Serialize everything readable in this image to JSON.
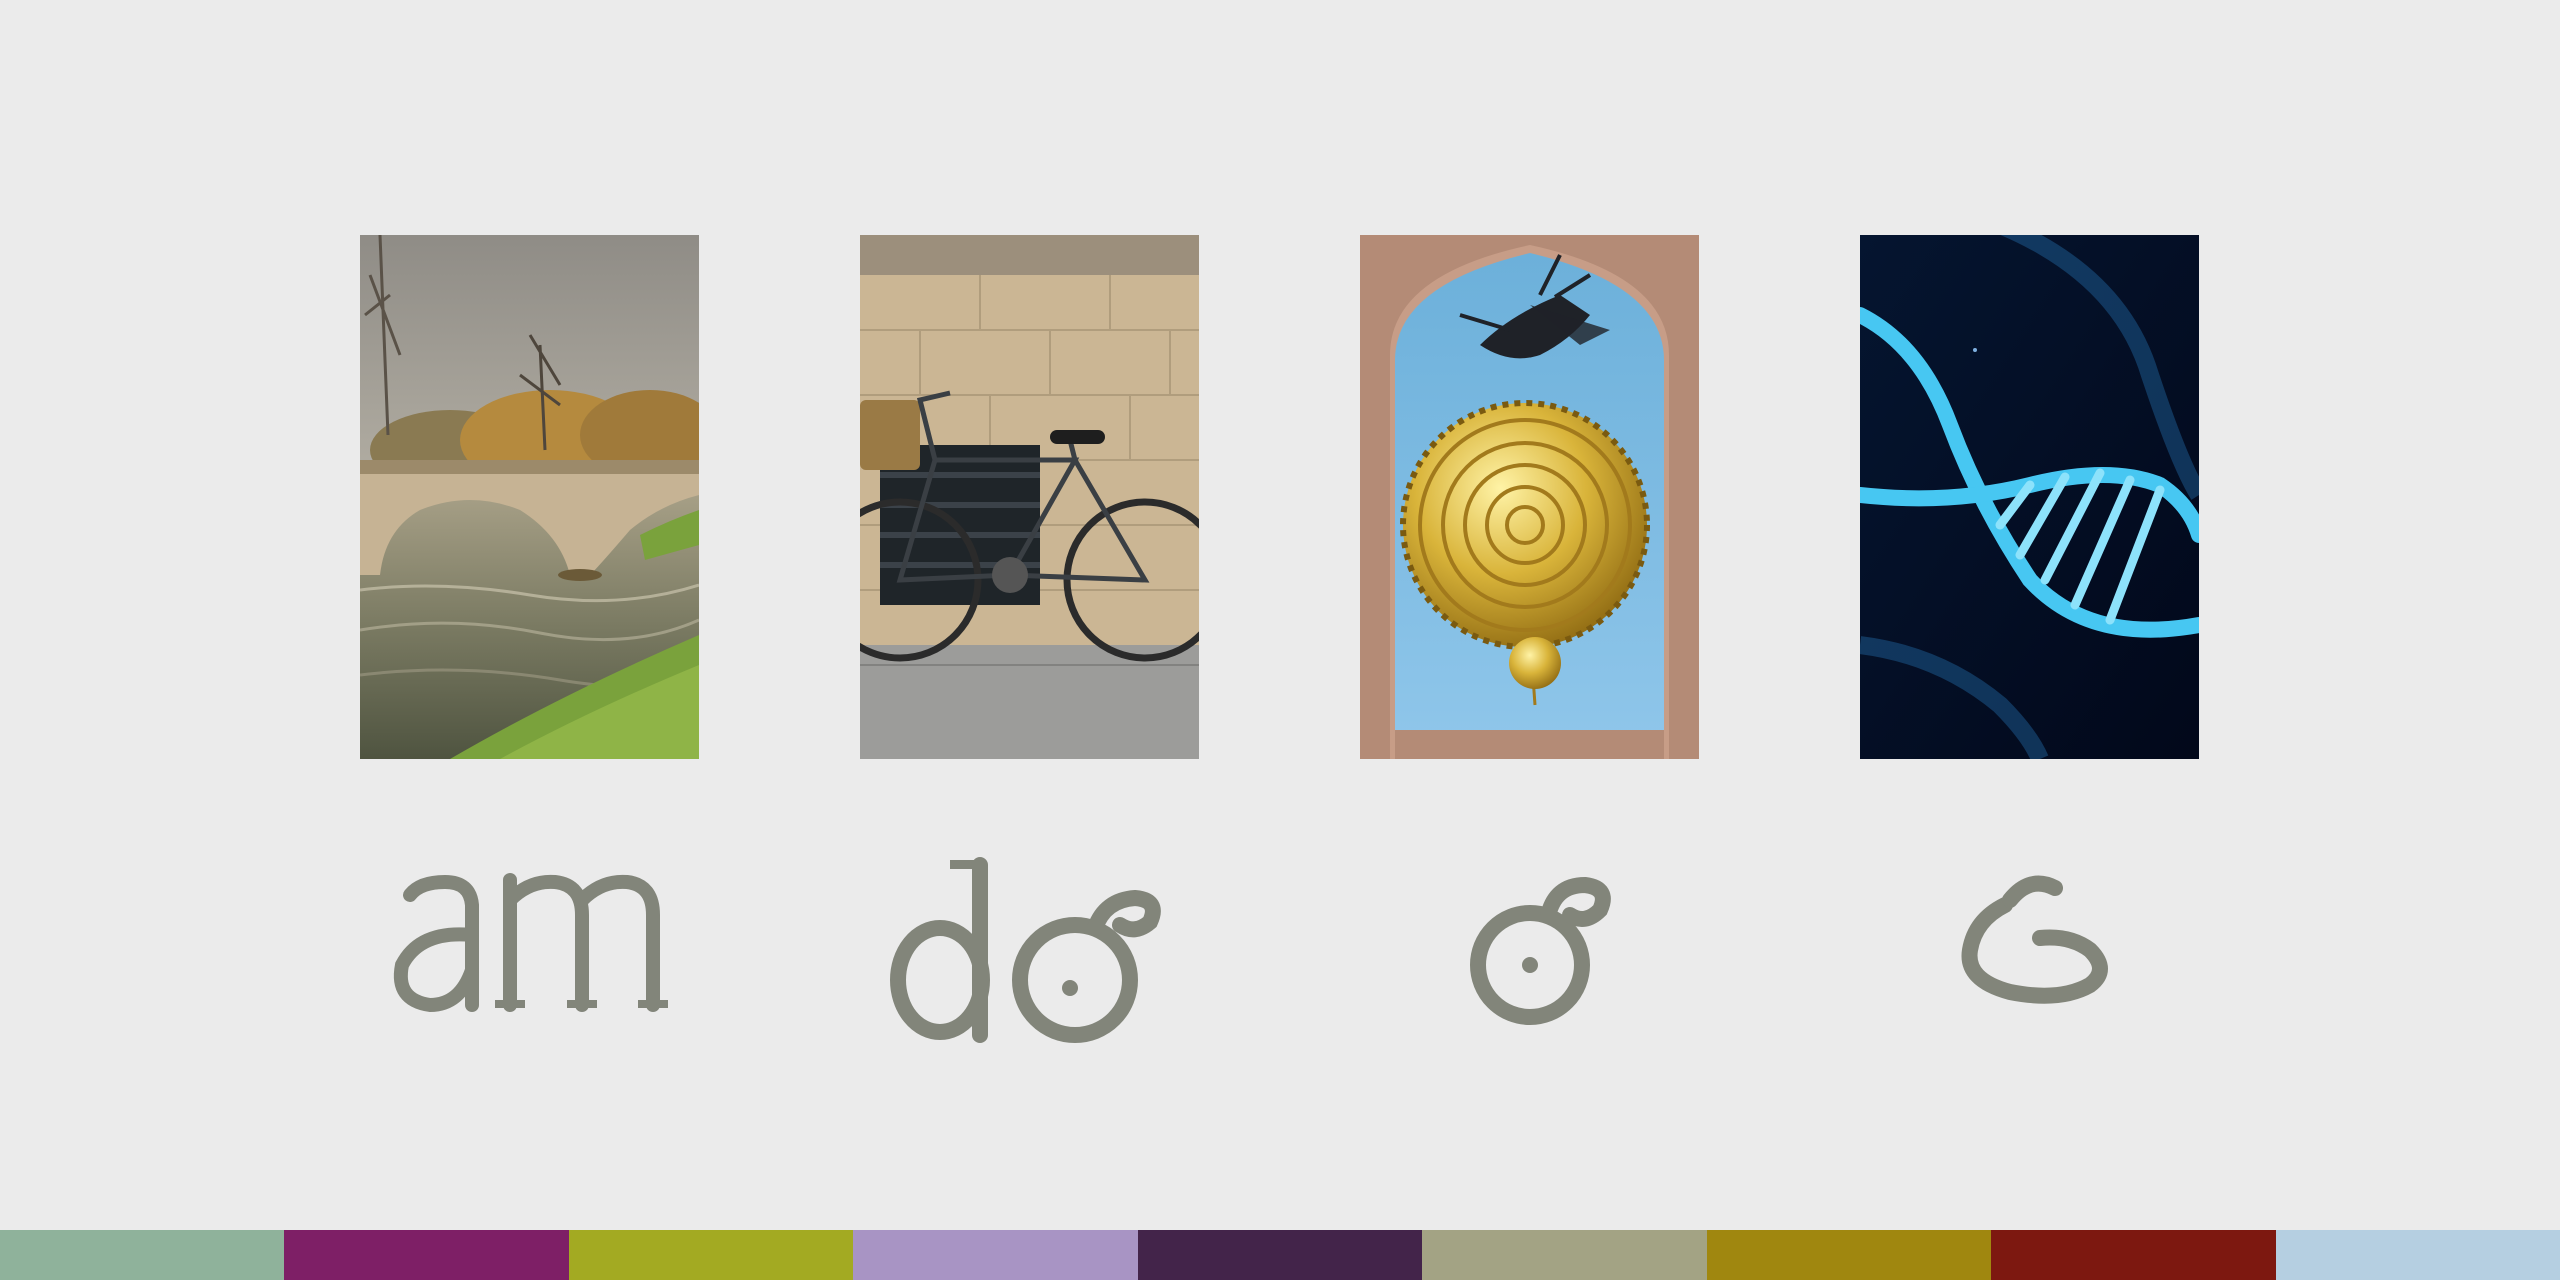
{
  "images": [
    {
      "icon": "stone-bridge-over-river-image"
    },
    {
      "icon": "bicycle-against-stone-wall-image"
    },
    {
      "icon": "golden-corpus-clock-image"
    },
    {
      "icon": "dna-double-helix-image"
    }
  ],
  "glyph_color": "#82857a",
  "palette": [
    "#8fb29b",
    "#7e1f66",
    "#a3aa22",
    "#a894c4",
    "#43244a",
    "#a3a384",
    "#a0870f",
    "#7d1810",
    "#b5cfe1"
  ]
}
